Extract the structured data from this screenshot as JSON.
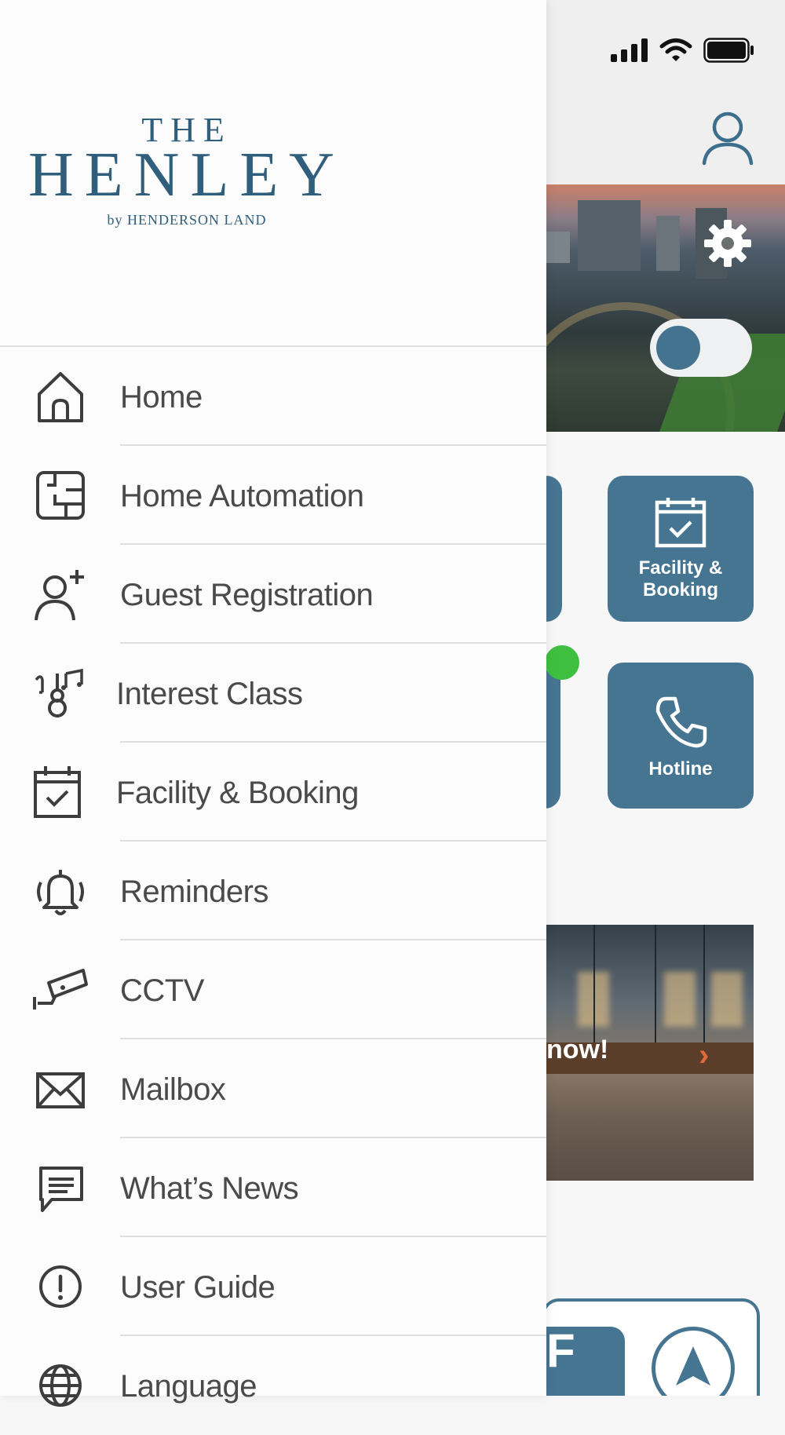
{
  "brand": {
    "logo_the": "THE",
    "logo_main": "HENLEY",
    "logo_by": "by HENDERSON LAND",
    "accent_color": "#467592"
  },
  "menu": {
    "items": [
      {
        "label": "Home",
        "icon": "home-icon"
      },
      {
        "label": "Home Automation",
        "icon": "floorplan-icon"
      },
      {
        "label": "Guest Registration",
        "icon": "add-user-icon"
      },
      {
        "label": "Interest Class",
        "icon": "music-guitar-icon"
      },
      {
        "label": "Facility & Booking",
        "icon": "calendar-check-icon"
      },
      {
        "label": "Reminders",
        "icon": "ringing-bell-icon"
      },
      {
        "label": "CCTV",
        "icon": "cctv-camera-icon"
      },
      {
        "label": "Mailbox",
        "icon": "envelope-icon"
      },
      {
        "label": "What’s News",
        "icon": "chat-bubble-icon"
      },
      {
        "label": "User Guide",
        "icon": "exclamation-circle-icon"
      },
      {
        "label": "Language",
        "icon": "globe-icon"
      }
    ]
  },
  "background_app": {
    "tiles": [
      {
        "label_line1": "Facility &",
        "label_line2": "Booking",
        "icon": "calendar-check-icon"
      },
      {
        "label": "Hotline",
        "icon": "phone-icon"
      }
    ],
    "promo_text": "now!",
    "bottom_tile_letter": "F",
    "notification_color": "#3fbf3f"
  }
}
